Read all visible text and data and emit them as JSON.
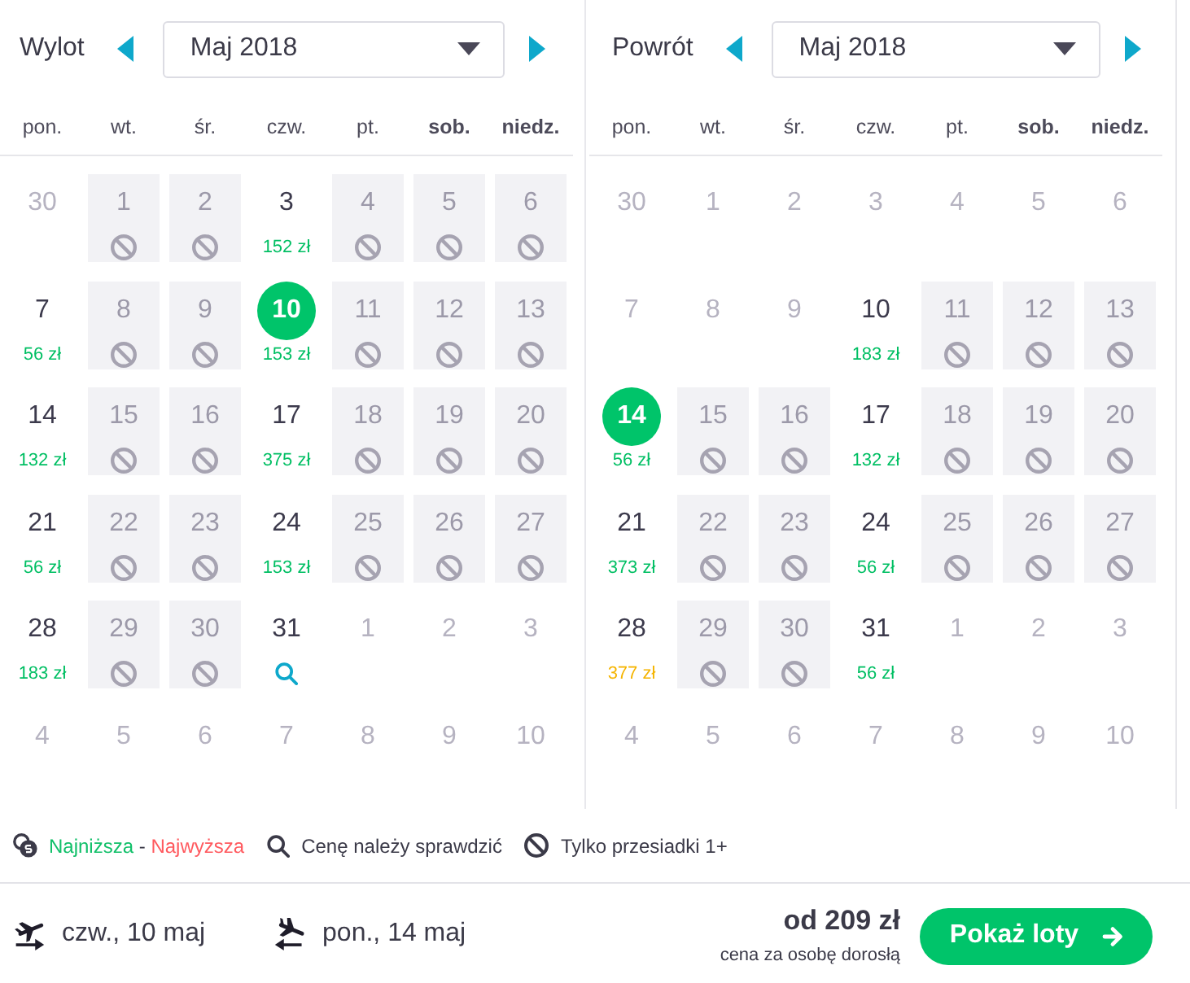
{
  "calendars": [
    {
      "label": "Wylot",
      "month": "Maj 2018",
      "weekdays": [
        {
          "label": "pon.",
          "weekend": false
        },
        {
          "label": "wt.",
          "weekend": false
        },
        {
          "label": "śr.",
          "weekend": false
        },
        {
          "label": "czw.",
          "weekend": false
        },
        {
          "label": "pt.",
          "weekend": false
        },
        {
          "label": "sob.",
          "weekend": true
        },
        {
          "label": "niedz.",
          "weekend": true
        }
      ],
      "days": [
        {
          "day": "30",
          "kind": "faded",
          "selected": false
        },
        {
          "day": "1",
          "kind": "blocked",
          "selected": false
        },
        {
          "day": "2",
          "kind": "blocked",
          "selected": false
        },
        {
          "day": "3",
          "kind": "priced",
          "price": "152 zł",
          "color": "#00bf63",
          "selected": false
        },
        {
          "day": "4",
          "kind": "blocked",
          "selected": false
        },
        {
          "day": "5",
          "kind": "blocked",
          "selected": false
        },
        {
          "day": "6",
          "kind": "blocked",
          "selected": false
        },
        {
          "day": "7",
          "kind": "priced",
          "price": "56 zł",
          "color": "#00bf63",
          "selected": false
        },
        {
          "day": "8",
          "kind": "blocked",
          "selected": false
        },
        {
          "day": "9",
          "kind": "blocked",
          "selected": false
        },
        {
          "day": "10",
          "kind": "priced",
          "price": "153 zł",
          "color": "#00bf63",
          "selected": true
        },
        {
          "day": "11",
          "kind": "blocked",
          "selected": false
        },
        {
          "day": "12",
          "kind": "blocked",
          "selected": false
        },
        {
          "day": "13",
          "kind": "blocked",
          "selected": false
        },
        {
          "day": "14",
          "kind": "priced",
          "price": "132 zł",
          "color": "#00bf63",
          "selected": false
        },
        {
          "day": "15",
          "kind": "blocked",
          "selected": false
        },
        {
          "day": "16",
          "kind": "blocked",
          "selected": false
        },
        {
          "day": "17",
          "kind": "priced",
          "price": "375 zł",
          "color": "#00bf63",
          "selected": false
        },
        {
          "day": "18",
          "kind": "blocked",
          "selected": false
        },
        {
          "day": "19",
          "kind": "blocked",
          "selected": false
        },
        {
          "day": "20",
          "kind": "blocked",
          "selected": false
        },
        {
          "day": "21",
          "kind": "priced",
          "price": "56 zł",
          "color": "#00bf63",
          "selected": false
        },
        {
          "day": "22",
          "kind": "blocked",
          "selected": false
        },
        {
          "day": "23",
          "kind": "blocked",
          "selected": false
        },
        {
          "day": "24",
          "kind": "priced",
          "price": "153 zł",
          "color": "#00bf63",
          "selected": false
        },
        {
          "day": "25",
          "kind": "blocked",
          "selected": false
        },
        {
          "day": "26",
          "kind": "blocked",
          "selected": false
        },
        {
          "day": "27",
          "kind": "blocked",
          "selected": false
        },
        {
          "day": "28",
          "kind": "priced",
          "price": "183 zł",
          "color": "#00bf63",
          "selected": false
        },
        {
          "day": "29",
          "kind": "blocked",
          "selected": false
        },
        {
          "day": "30",
          "kind": "blocked",
          "selected": false
        },
        {
          "day": "31",
          "kind": "check",
          "selected": false
        },
        {
          "day": "1",
          "kind": "faded",
          "selected": false
        },
        {
          "day": "2",
          "kind": "faded",
          "selected": false
        },
        {
          "day": "3",
          "kind": "faded",
          "selected": false
        },
        {
          "day": "4",
          "kind": "faded",
          "selected": false
        },
        {
          "day": "5",
          "kind": "faded",
          "selected": false
        },
        {
          "day": "6",
          "kind": "faded",
          "selected": false
        },
        {
          "day": "7",
          "kind": "faded",
          "selected": false
        },
        {
          "day": "8",
          "kind": "faded",
          "selected": false
        },
        {
          "day": "9",
          "kind": "faded",
          "selected": false
        },
        {
          "day": "10",
          "kind": "faded",
          "selected": false
        }
      ]
    },
    {
      "label": "Powrót",
      "month": "Maj 2018",
      "weekdays": [
        {
          "label": "pon.",
          "weekend": false
        },
        {
          "label": "wt.",
          "weekend": false
        },
        {
          "label": "śr.",
          "weekend": false
        },
        {
          "label": "czw.",
          "weekend": false
        },
        {
          "label": "pt.",
          "weekend": false
        },
        {
          "label": "sob.",
          "weekend": true
        },
        {
          "label": "niedz.",
          "weekend": true
        }
      ],
      "days": [
        {
          "day": "30",
          "kind": "faded",
          "selected": false
        },
        {
          "day": "1",
          "kind": "faded",
          "selected": false
        },
        {
          "day": "2",
          "kind": "faded",
          "selected": false
        },
        {
          "day": "3",
          "kind": "faded",
          "selected": false
        },
        {
          "day": "4",
          "kind": "faded",
          "selected": false
        },
        {
          "day": "5",
          "kind": "faded",
          "selected": false
        },
        {
          "day": "6",
          "kind": "faded",
          "selected": false
        },
        {
          "day": "7",
          "kind": "faded",
          "selected": false
        },
        {
          "day": "8",
          "kind": "faded",
          "selected": false
        },
        {
          "day": "9",
          "kind": "faded",
          "selected": false
        },
        {
          "day": "10",
          "kind": "priced",
          "price": "183 zł",
          "color": "#00bf63",
          "selected": false
        },
        {
          "day": "11",
          "kind": "blocked",
          "selected": false
        },
        {
          "day": "12",
          "kind": "blocked",
          "selected": false
        },
        {
          "day": "13",
          "kind": "blocked",
          "selected": false
        },
        {
          "day": "14",
          "kind": "priced",
          "price": "56 zł",
          "color": "#00bf63",
          "selected": true
        },
        {
          "day": "15",
          "kind": "blocked",
          "selected": false
        },
        {
          "day": "16",
          "kind": "blocked",
          "selected": false
        },
        {
          "day": "17",
          "kind": "priced",
          "price": "132 zł",
          "color": "#00bf63",
          "selected": false
        },
        {
          "day": "18",
          "kind": "blocked",
          "selected": false
        },
        {
          "day": "19",
          "kind": "blocked",
          "selected": false
        },
        {
          "day": "20",
          "kind": "blocked",
          "selected": false
        },
        {
          "day": "21",
          "kind": "priced",
          "price": "373 zł",
          "color": "#00bf63",
          "selected": false
        },
        {
          "day": "22",
          "kind": "blocked",
          "selected": false
        },
        {
          "day": "23",
          "kind": "blocked",
          "selected": false
        },
        {
          "day": "24",
          "kind": "priced",
          "price": "56 zł",
          "color": "#00bf63",
          "selected": false
        },
        {
          "day": "25",
          "kind": "blocked",
          "selected": false
        },
        {
          "day": "26",
          "kind": "blocked",
          "selected": false
        },
        {
          "day": "27",
          "kind": "blocked",
          "selected": false
        },
        {
          "day": "28",
          "kind": "priced",
          "price": "377 zł",
          "color": "#f5b400",
          "selected": false
        },
        {
          "day": "29",
          "kind": "blocked",
          "selected": false
        },
        {
          "day": "30",
          "kind": "blocked",
          "selected": false
        },
        {
          "day": "31",
          "kind": "priced",
          "price": "56 zł",
          "color": "#00bf63",
          "selected": false
        },
        {
          "day": "1",
          "kind": "faded",
          "selected": false
        },
        {
          "day": "2",
          "kind": "faded",
          "selected": false
        },
        {
          "day": "3",
          "kind": "faded",
          "selected": false
        },
        {
          "day": "4",
          "kind": "faded",
          "selected": false
        },
        {
          "day": "5",
          "kind": "faded",
          "selected": false
        },
        {
          "day": "6",
          "kind": "faded",
          "selected": false
        },
        {
          "day": "7",
          "kind": "faded",
          "selected": false
        },
        {
          "day": "8",
          "kind": "faded",
          "selected": false
        },
        {
          "day": "9",
          "kind": "faded",
          "selected": false
        },
        {
          "day": "10",
          "kind": "faded",
          "selected": false
        }
      ]
    }
  ],
  "legend": {
    "items": [
      {
        "kind": "price_range",
        "low": "Najniższa",
        "separator": "-",
        "high": "Najwyższa"
      },
      {
        "kind": "check",
        "text": "Cenę należy sprawdzić"
      },
      {
        "kind": "transfer",
        "text": "Tylko przesiadki 1+"
      }
    ]
  },
  "footer": {
    "legs": [
      {
        "kind": "outbound",
        "date": "czw., 10 maj"
      },
      {
        "kind": "return",
        "date": "pon., 14 maj"
      }
    ],
    "price": "od 209 zł",
    "price_note": "cena za osobę dorosłą",
    "button": "Pokaż loty"
  }
}
